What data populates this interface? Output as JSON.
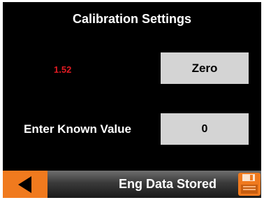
{
  "header": {
    "title": "Calibration Settings"
  },
  "calibration": {
    "reading": "1.52",
    "reading_color": "#e21b23",
    "zero_label": "Zero",
    "known_value_label": "Enter Known Value",
    "known_value": "0"
  },
  "status_bar": {
    "status_text": "Eng Data Stored",
    "accent_color": "#f07a1e",
    "back_icon": "back-arrow-icon",
    "save_icon": "save-floppy-icon"
  }
}
